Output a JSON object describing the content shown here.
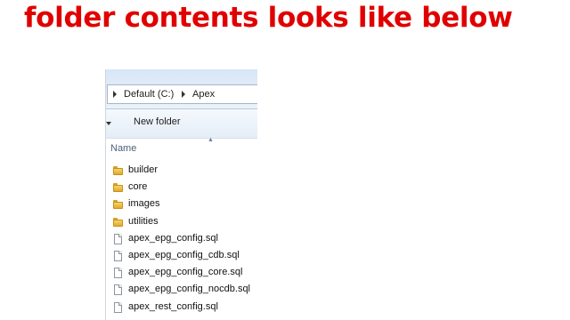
{
  "slide": {
    "title": "folder contents looks like below",
    "title_color": "#e00000"
  },
  "explorer": {
    "breadcrumb": [
      "Default (C:)",
      "Apex"
    ],
    "toolbar": {
      "new_folder_label": "New folder"
    },
    "column_header": "Name",
    "items": [
      {
        "name": "builder",
        "type": "folder"
      },
      {
        "name": "core",
        "type": "folder"
      },
      {
        "name": "images",
        "type": "folder"
      },
      {
        "name": "utilities",
        "type": "folder"
      },
      {
        "name": "apex_epg_config.sql",
        "type": "file"
      },
      {
        "name": "apex_epg_config_cdb.sql",
        "type": "file"
      },
      {
        "name": "apex_epg_config_core.sql",
        "type": "file"
      },
      {
        "name": "apex_epg_config_nocdb.sql",
        "type": "file"
      },
      {
        "name": "apex_rest_config.sql",
        "type": "file"
      }
    ]
  }
}
